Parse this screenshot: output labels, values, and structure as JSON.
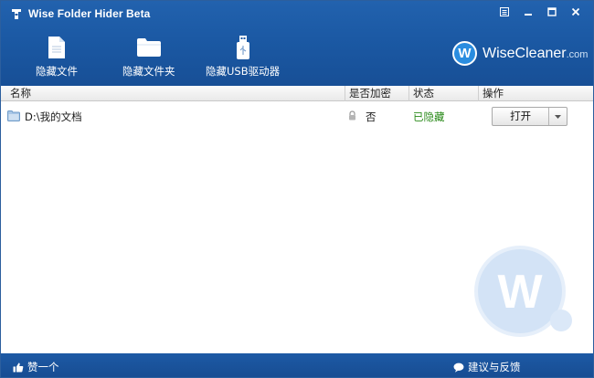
{
  "app": {
    "title": "Wise Folder Hider Beta"
  },
  "toolbar": {
    "hide_file": "隐藏文件",
    "hide_folder": "隐藏文件夹",
    "hide_usb": "隐藏USB驱动器"
  },
  "brand": {
    "logo_letter": "W",
    "name": "WiseCleaner",
    "domain": ".com"
  },
  "columns": {
    "name": "名称",
    "encrypted": "是否加密",
    "status": "状态",
    "action": "操作"
  },
  "rows": [
    {
      "path": "D:\\我的文档",
      "encrypted": "否",
      "status": "已隐藏",
      "action": "打开"
    }
  ],
  "watermark": {
    "letter": "W"
  },
  "footer": {
    "like": "赞一个",
    "feedback": "建议与反馈"
  },
  "colors": {
    "header_blue": "#1b59a4",
    "status_green": "#2a8a1a",
    "brand_blue": "#2a8de0"
  }
}
